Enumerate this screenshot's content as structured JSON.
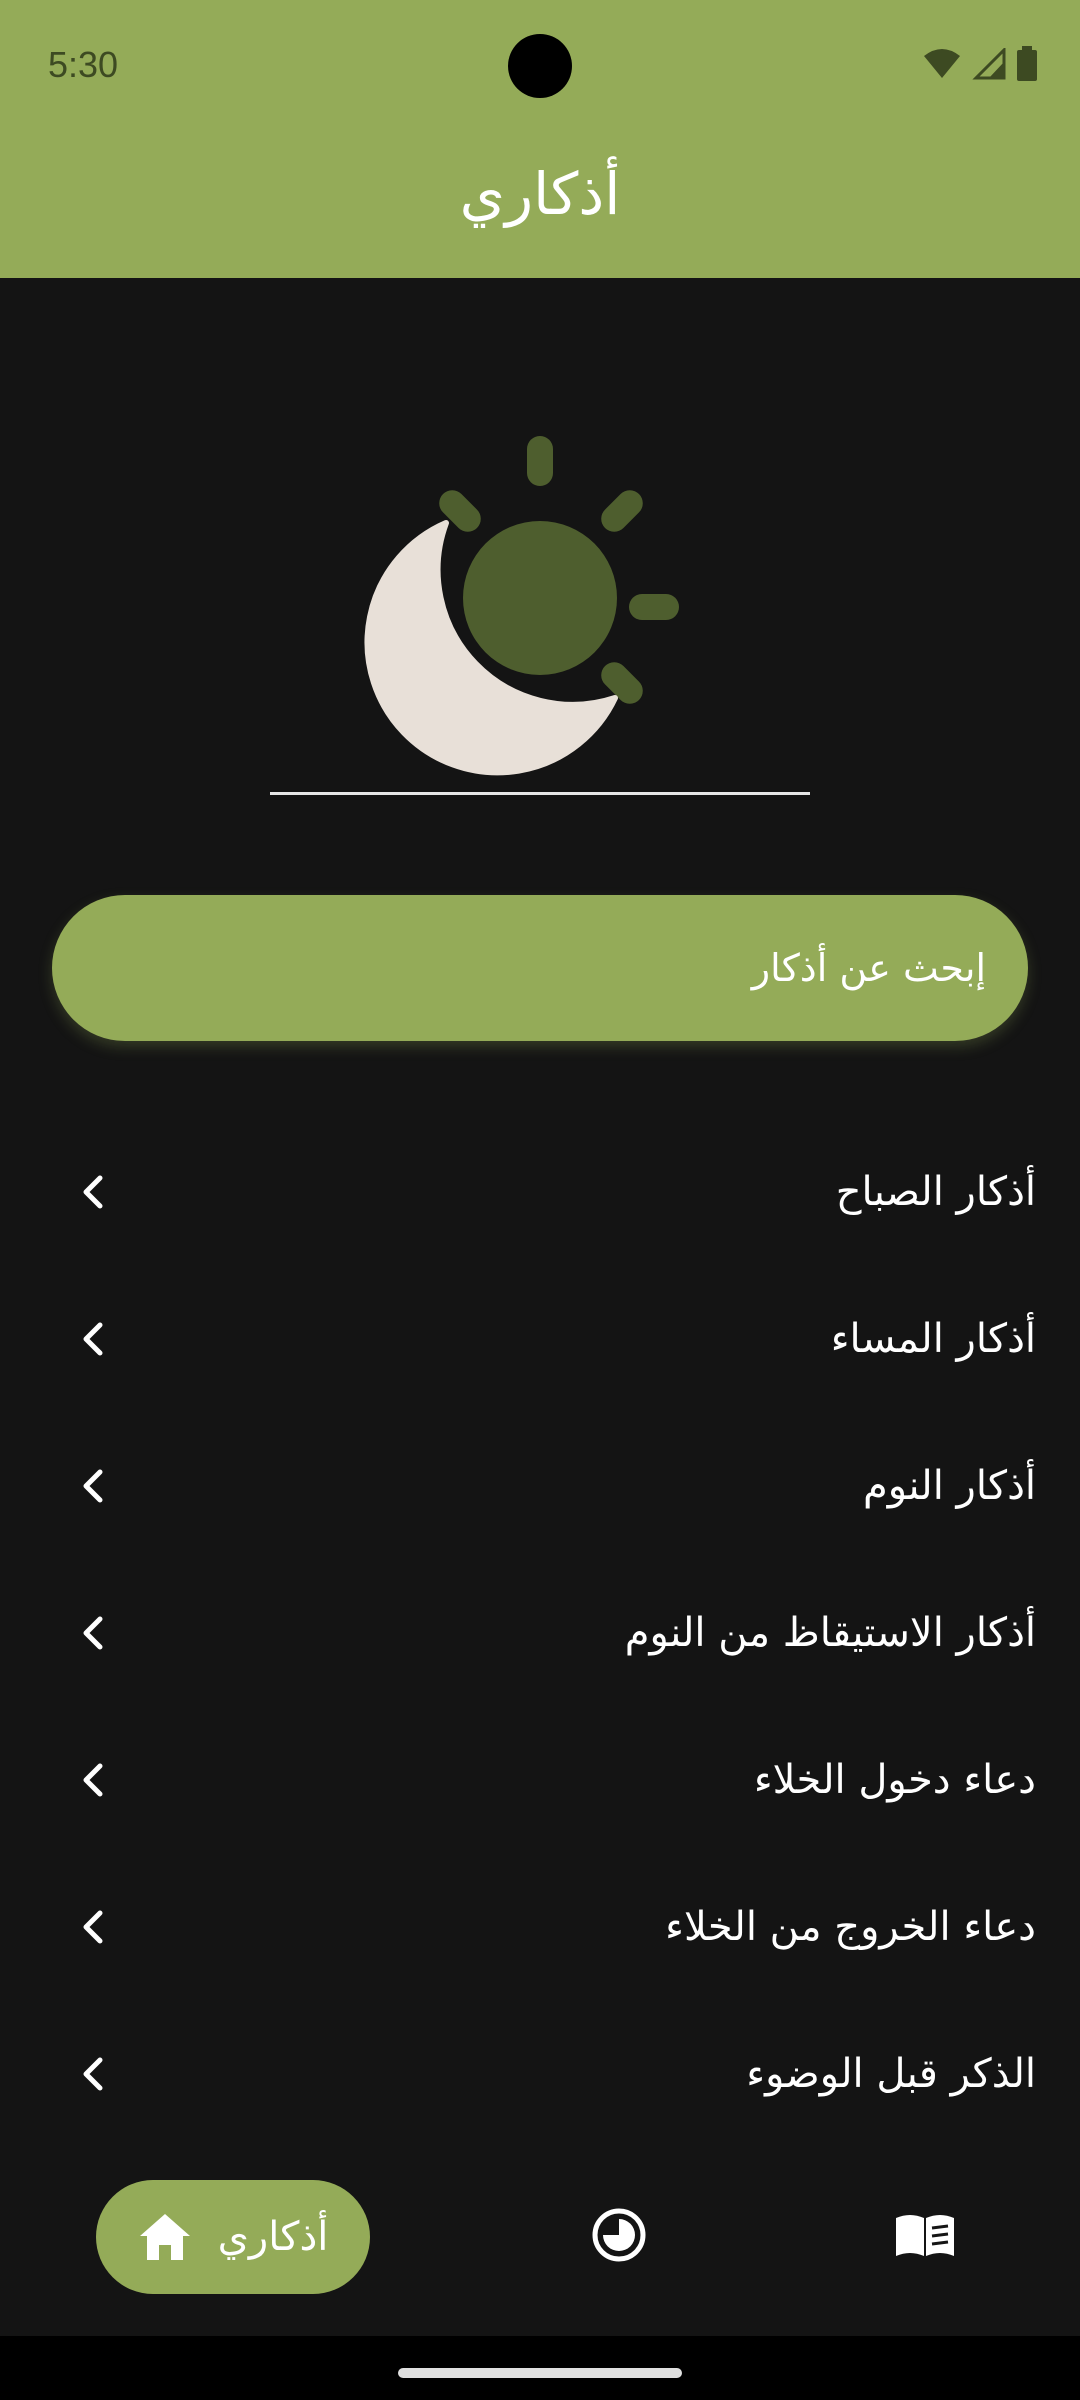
{
  "status_bar": {
    "time": "5:30",
    "icons": [
      "wifi-icon",
      "cell-signal-icon",
      "battery-icon"
    ]
  },
  "header": {
    "title": "أذكاري",
    "background_color": "#94AB58"
  },
  "hero": {
    "icon": "moon-sun-icon",
    "colors": {
      "moon": "#E8E0D8",
      "sun": "#4E5E2E"
    }
  },
  "search": {
    "placeholder": "إبحث عن أذكار"
  },
  "list": {
    "items": [
      {
        "label": "أذكار الصباح"
      },
      {
        "label": "أذكار المساء"
      },
      {
        "label": "أذكار النوم"
      },
      {
        "label": "أذكار الاستيقاظ من النوم"
      },
      {
        "label": "دعاء دخول الخلاء"
      },
      {
        "label": "دعاء الخروج من الخلاء"
      },
      {
        "label": "الذكر قبل الوضوء"
      }
    ],
    "item_icon": "chevron-left-icon"
  },
  "bottom_nav": {
    "items": [
      {
        "label": "أذكاري",
        "icon": "home-icon",
        "active": true
      },
      {
        "label": "",
        "icon": "clock-icon",
        "active": false
      },
      {
        "label": "",
        "icon": "book-icon",
        "active": false
      }
    ]
  },
  "colors": {
    "accent": "#94AB58",
    "background": "#141414",
    "text": "#FFFFFF"
  }
}
